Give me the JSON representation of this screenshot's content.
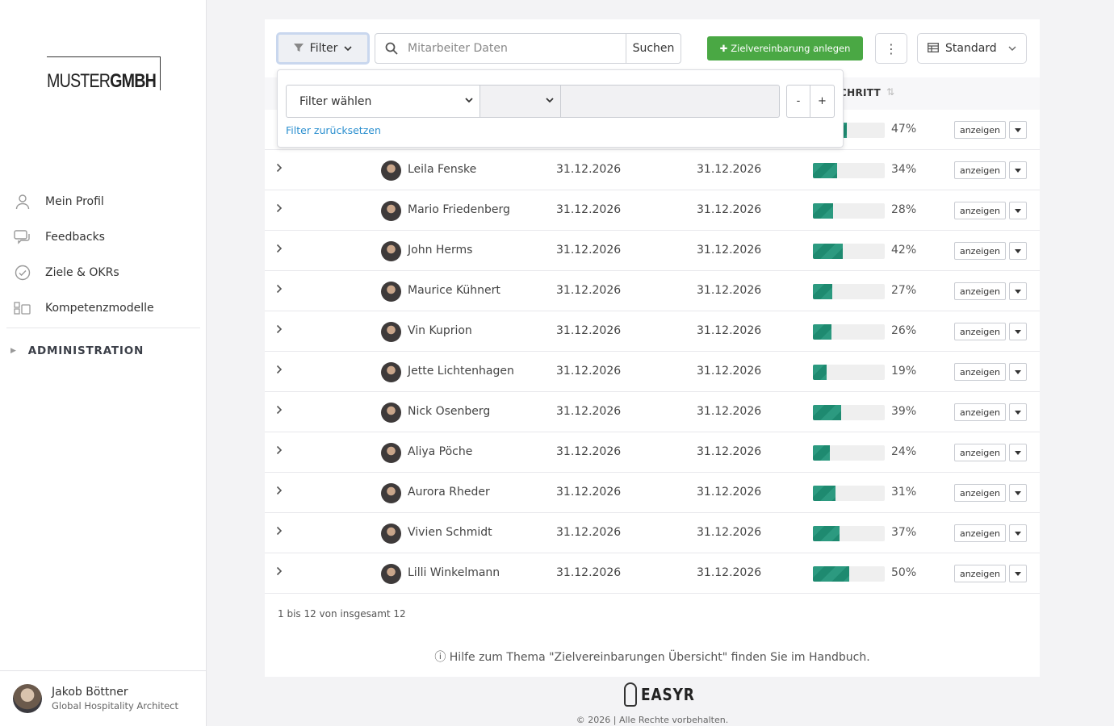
{
  "company_logo": {
    "thin": "MUSTER",
    "bold": "GMBH"
  },
  "sidebar": {
    "items": [
      {
        "label": "Mein Profil",
        "icon": "user-icon"
      },
      {
        "label": "Feedbacks",
        "icon": "chat-icon"
      },
      {
        "label": "Ziele & OKRs",
        "icon": "check-circle-icon"
      },
      {
        "label": "Kompetenzmodelle",
        "icon": "blocks-icon"
      }
    ],
    "admin_label": "ADMINISTRATION"
  },
  "user": {
    "name": "Jakob Böttner",
    "role": "Global Hospitality Architect"
  },
  "toolbar": {
    "filter_label": "Filter",
    "search_placeholder": "Mitarbeiter Daten",
    "search_button": "Suchen",
    "add_button": "Zielvereinbarung anlegen",
    "view_label": "Standard"
  },
  "filter_panel": {
    "select_label": "Filter wählen",
    "reset_link": "Filter zurücksetzen",
    "minus": "-",
    "plus": "+"
  },
  "table": {
    "progress_header_fragment": "CHRITT",
    "show_label": "anzeigen",
    "rows": [
      {
        "name": "",
        "date1": "",
        "date2": "",
        "progress": 47
      },
      {
        "name": "Leila Fenske",
        "date1": "31.12.2026",
        "date2": "31.12.2026",
        "progress": 34
      },
      {
        "name": "Mario Friedenberg",
        "date1": "31.12.2026",
        "date2": "31.12.2026",
        "progress": 28
      },
      {
        "name": "John Herms",
        "date1": "31.12.2026",
        "date2": "31.12.2026",
        "progress": 42
      },
      {
        "name": "Maurice Kühnert",
        "date1": "31.12.2026",
        "date2": "31.12.2026",
        "progress": 27
      },
      {
        "name": "Vin Kuprion",
        "date1": "31.12.2026",
        "date2": "31.12.2026",
        "progress": 26
      },
      {
        "name": "Jette Lichtenhagen",
        "date1": "31.12.2026",
        "date2": "31.12.2026",
        "progress": 19
      },
      {
        "name": "Nick Osenberg",
        "date1": "31.12.2026",
        "date2": "31.12.2026",
        "progress": 39
      },
      {
        "name": "Aliya Pöche",
        "date1": "31.12.2026",
        "date2": "31.12.2026",
        "progress": 24
      },
      {
        "name": "Aurora Rheder",
        "date1": "31.12.2026",
        "date2": "31.12.2026",
        "progress": 31
      },
      {
        "name": "Vivien Schmidt",
        "date1": "31.12.2026",
        "date2": "31.12.2026",
        "progress": 37
      },
      {
        "name": "Lilli Winkelmann",
        "date1": "31.12.2026",
        "date2": "31.12.2026",
        "progress": 50
      }
    ]
  },
  "pager_text": "1 bis 12 von insgesamt 12",
  "help_text": "Hilfe zum Thema \"Zielvereinbarungen Übersicht\" finden Sie im Handbuch.",
  "footer": {
    "brand": "EASYR",
    "copyright": "© 2026 | Alle Rechte vorbehalten."
  },
  "colors": {
    "accent_green": "#4aa844",
    "progress": "#2c9a80",
    "link": "#2b8fcf"
  }
}
